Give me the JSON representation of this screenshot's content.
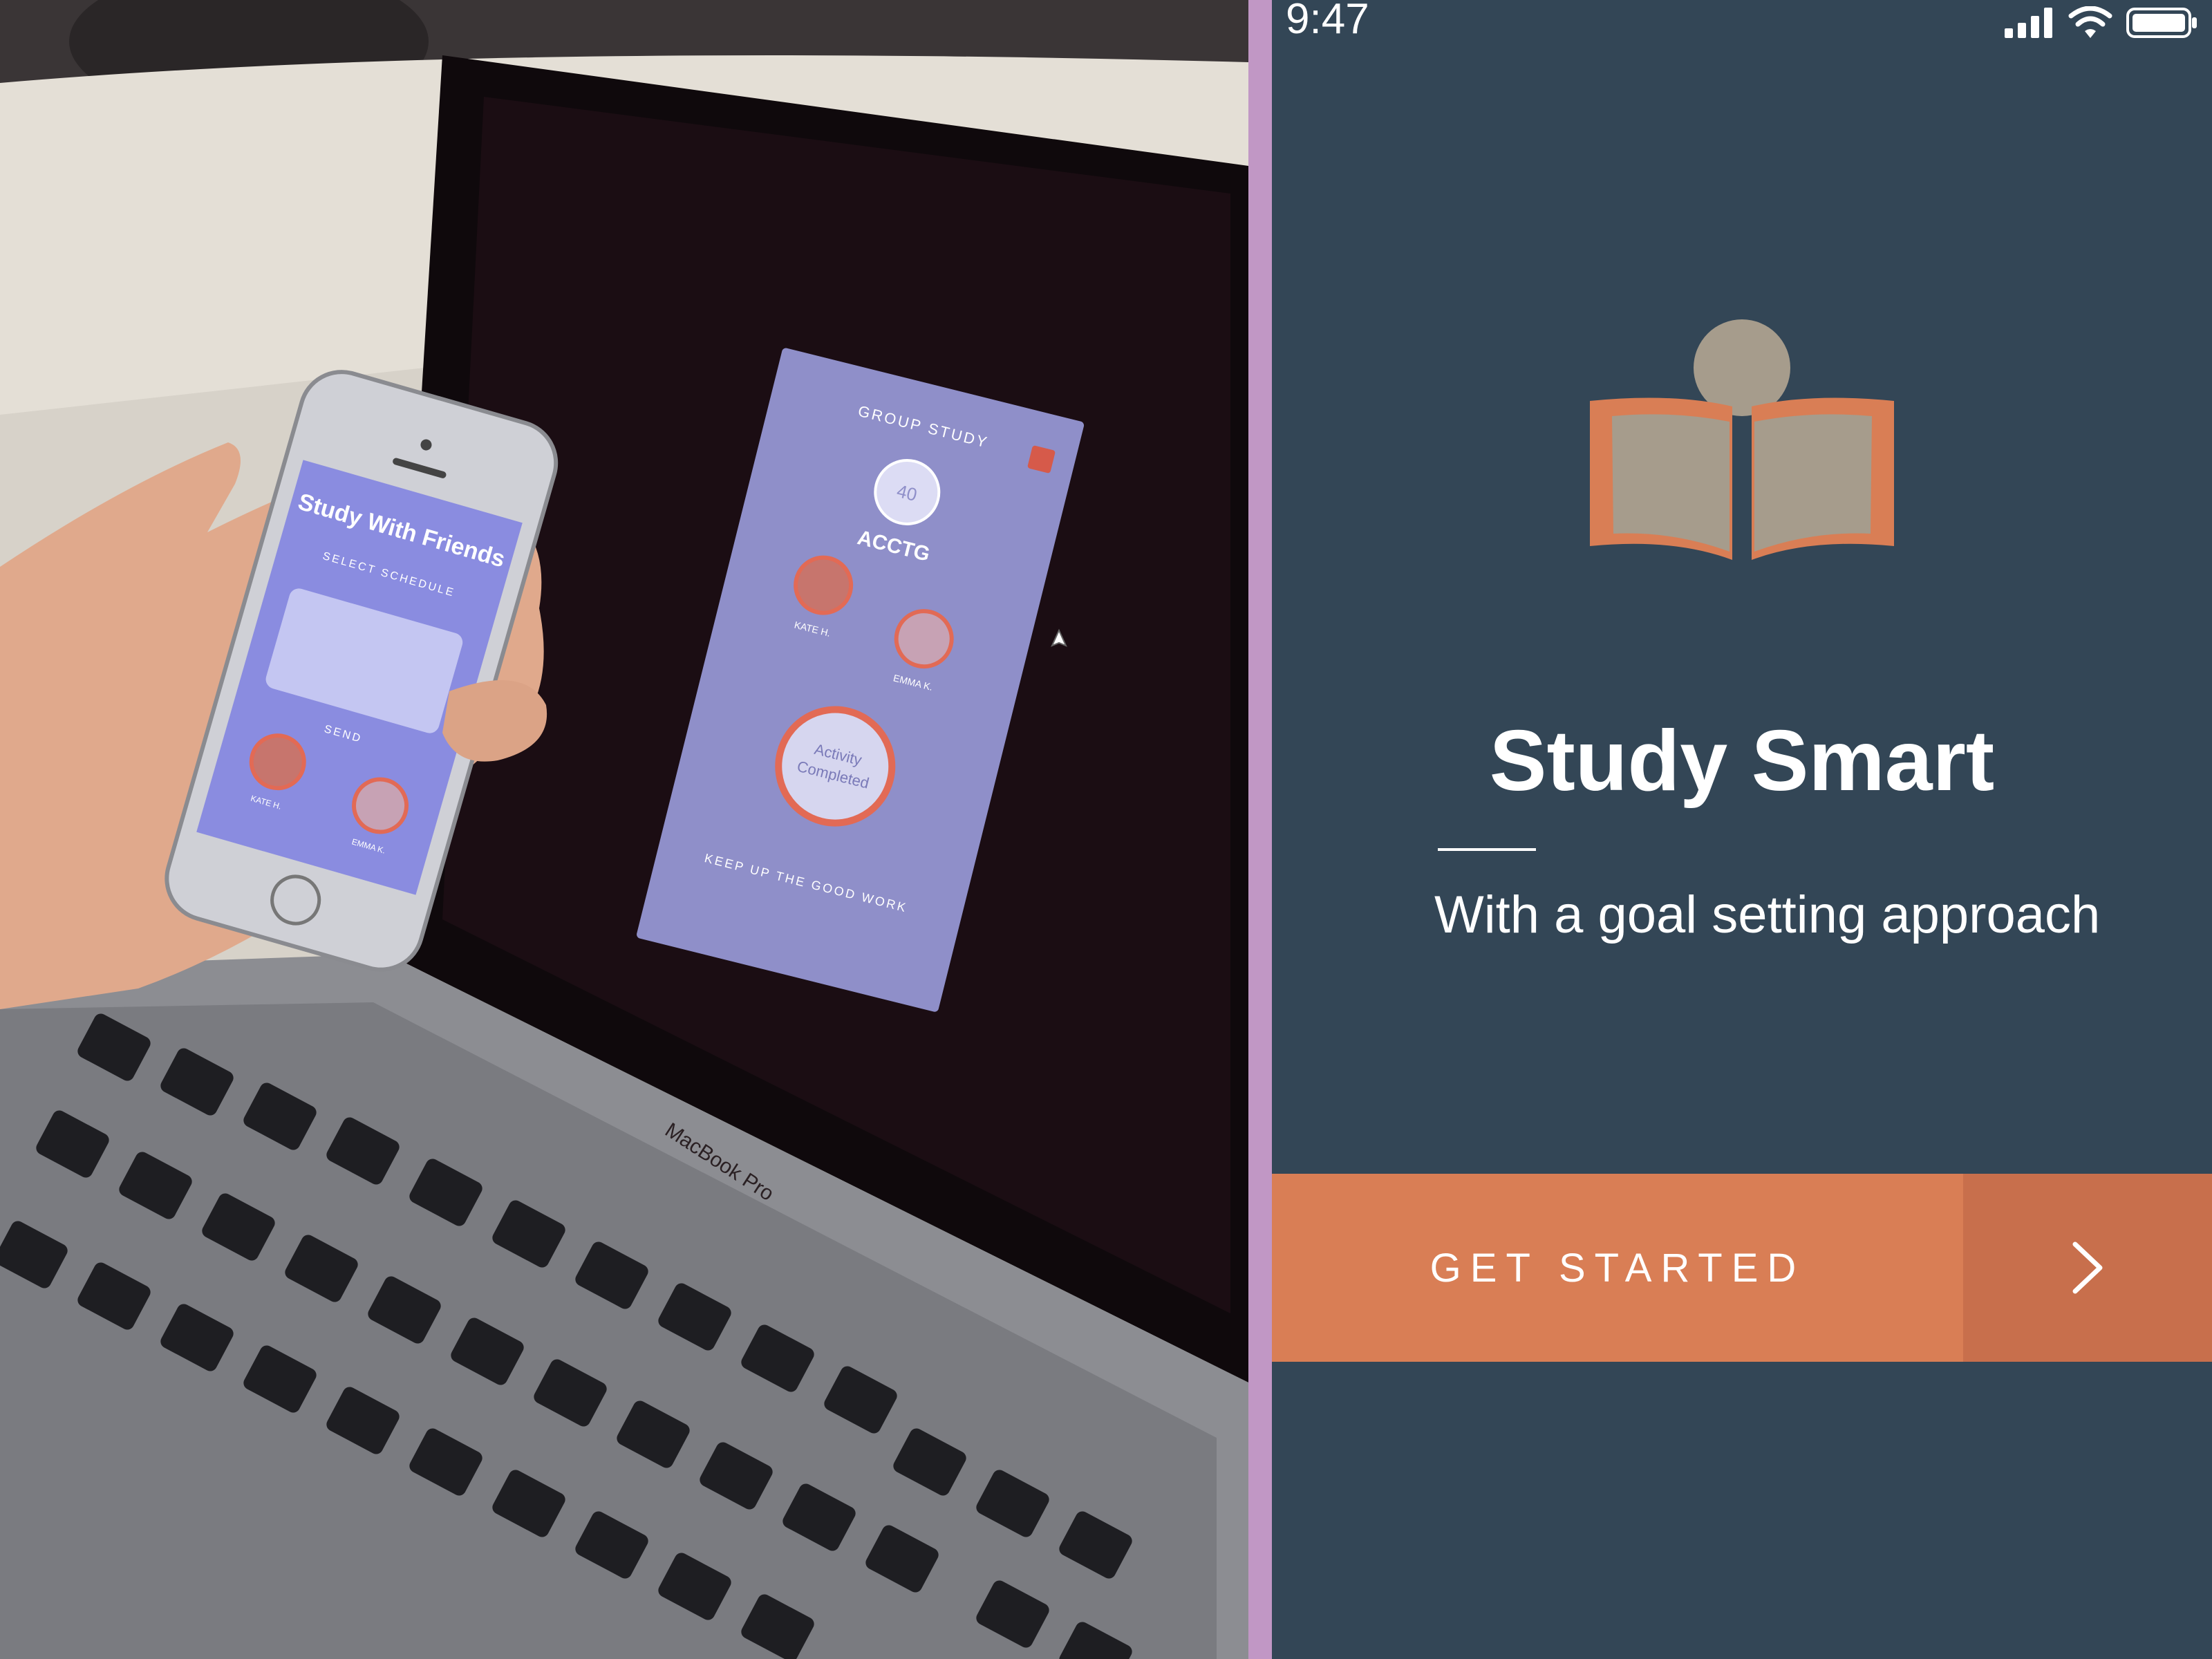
{
  "photo": {
    "phone_app": {
      "title": "Study With Friends",
      "section_select": "SELECT SCHEDULE",
      "section_send": "SEND",
      "friend_1": "KATE H.",
      "friend_2": "EMMA K."
    },
    "laptop_app": {
      "header": "GROUP STUDY",
      "badge_value": "40",
      "course": "ACCTG",
      "friend_1": "KATE H.",
      "friend_2": "EMMA K.",
      "activity_line1": "Activity",
      "activity_line2": "Completed",
      "footer": "KEEP UP THE GOOD WORK"
    },
    "laptop_label": "MacBook Pro"
  },
  "app": {
    "status": {
      "time": "9:47"
    },
    "title": "Study Smart",
    "subtitle": "With a goal setting approach",
    "cta": {
      "label": "GET STARTED"
    },
    "colors": {
      "background": "#334656",
      "accent": "#d97e55",
      "accent_dark": "#c86f4c",
      "book_pages": "#a69c8c",
      "divider": "#c197c5"
    },
    "icons": {
      "logo": "open-book-reader-icon",
      "cta_arrow": "chevron-right-icon"
    }
  }
}
